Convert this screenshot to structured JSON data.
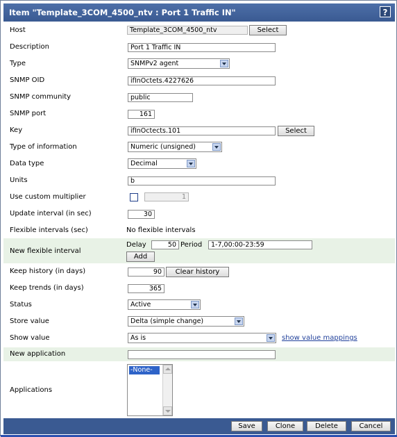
{
  "header": {
    "title": "Item \"Template_3COM_4500_ntv : Port 1 Traffic IN\"",
    "help_label": "?"
  },
  "fields": {
    "host": {
      "label": "Host",
      "value": "Template_3COM_4500_ntv",
      "button": "Select"
    },
    "description": {
      "label": "Description",
      "value": "Port 1 Traffic IN"
    },
    "type": {
      "label": "Type",
      "value": "SNMPv2 agent"
    },
    "snmp_oid": {
      "label": "SNMP OID",
      "value": "ifInOctets.4227626"
    },
    "snmp_community": {
      "label": "SNMP community",
      "value": "public"
    },
    "snmp_port": {
      "label": "SNMP port",
      "value": "161"
    },
    "key": {
      "label": "Key",
      "value": "ifInOctects.101",
      "button": "Select"
    },
    "type_of_information": {
      "label": "Type of information",
      "value": "Numeric (unsigned)"
    },
    "data_type": {
      "label": "Data type",
      "value": "Decimal"
    },
    "units": {
      "label": "Units",
      "value": "b"
    },
    "custom_multiplier": {
      "label": "Use custom multiplier",
      "checked": false,
      "value": "1"
    },
    "update_interval": {
      "label": "Update interval (in sec)",
      "value": "30"
    },
    "flexible_intervals": {
      "label": "Flexible intervals (sec)",
      "value": "No flexible intervals"
    },
    "new_flexible_interval": {
      "label": "New flexible interval",
      "delay_label": "Delay",
      "delay_value": "50",
      "period_label": "Period",
      "period_value": "1-7,00:00-23:59",
      "add_button": "Add"
    },
    "keep_history": {
      "label": "Keep history (in days)",
      "value": "90",
      "button": "Clear history"
    },
    "keep_trends": {
      "label": "Keep trends (in days)",
      "value": "365"
    },
    "status": {
      "label": "Status",
      "value": "Active"
    },
    "store_value": {
      "label": "Store value",
      "value": "Delta (simple change)"
    },
    "show_value": {
      "label": "Show value",
      "value": "As is",
      "link": "show value mappings"
    },
    "new_application": {
      "label": "New application",
      "value": ""
    },
    "applications": {
      "label": "Applications",
      "options": [
        "-None-"
      ]
    }
  },
  "footer": {
    "save": "Save",
    "clone": "Clone",
    "delete": "Delete",
    "cancel": "Cancel"
  },
  "colors": {
    "header": "#3a5a92",
    "highlight_row": "#e8f2e6",
    "link": "#1f3f9a",
    "selection": "#2e63c8"
  }
}
